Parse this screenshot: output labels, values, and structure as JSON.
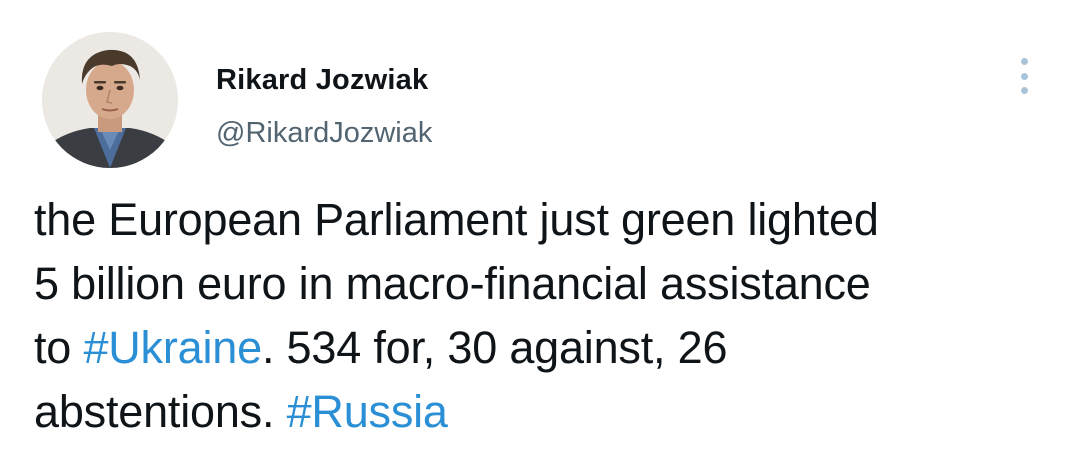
{
  "author": {
    "display_name": "Rikard Jozwiak",
    "handle": "@RikardJozwiak"
  },
  "more_menu": {
    "icon": "more-vertical-icon"
  },
  "tweet": {
    "lines": [
      {
        "text": "the European Parliament just green lighted"
      },
      {
        "text": "5 billion euro in macro-financial assistance"
      },
      {
        "before": "to ",
        "hashtag": "#Ukraine",
        "after": ". 534 for, 30 against, 26"
      },
      {
        "before": "abstentions. ",
        "hashtag": "#Russia"
      }
    ]
  },
  "colors": {
    "hashtag": "#2a8fd4",
    "text": "#0f1419",
    "handle": "#536471",
    "more_dots": "#a9c4d8"
  }
}
